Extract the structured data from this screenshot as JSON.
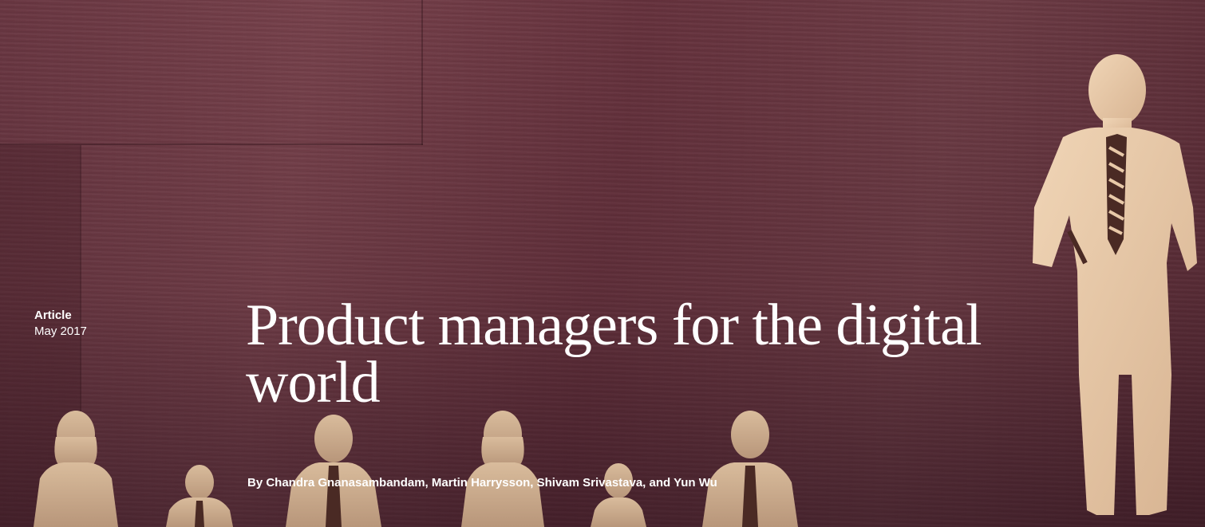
{
  "hero": {
    "article_type": "Article",
    "date": "May 2017",
    "title": "Product managers for the digital world",
    "byline": "By Chandra Gnanasambandam, Martin Harrysson, Shivam Srivastava, and Yun Wu",
    "colors": {
      "wood_base": "#6e3a45",
      "figure": "#e8c9a8",
      "text": "#ffffff"
    }
  }
}
